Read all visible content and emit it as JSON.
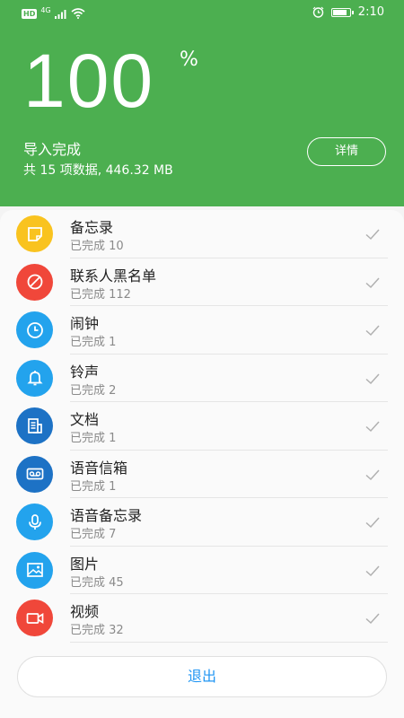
{
  "status_bar": {
    "hd": "HD",
    "network": "4G",
    "time": "2:10",
    "battery_level": 0.85
  },
  "header": {
    "percent_value": "100",
    "percent_sign": "%",
    "import_status": "导入完成",
    "summary": "共 15 项数据, 446.32 MB",
    "details_button": "详情"
  },
  "items": [
    {
      "title": "备忘录",
      "sub": "已完成  10",
      "icon": "memo-icon",
      "color": "#f9c31f"
    },
    {
      "title": "联系人黑名单",
      "sub": "已完成  112",
      "icon": "block-icon",
      "color": "#f0473a"
    },
    {
      "title": "闹钟",
      "sub": "已完成  1",
      "icon": "clock-icon",
      "color": "#23a3ed"
    },
    {
      "title": "铃声",
      "sub": "已完成  2",
      "icon": "bell-icon",
      "color": "#23a3ed"
    },
    {
      "title": "文档",
      "sub": "已完成  1",
      "icon": "document-icon",
      "color": "#1d72c5"
    },
    {
      "title": "语音信箱",
      "sub": "已完成  1",
      "icon": "voicemail-icon",
      "color": "#1d72c5"
    },
    {
      "title": "语音备忘录",
      "sub": "已完成  7",
      "icon": "microphone-icon",
      "color": "#23a3ed"
    },
    {
      "title": "图片",
      "sub": "已完成  45",
      "icon": "image-icon",
      "color": "#23a3ed"
    },
    {
      "title": "视频",
      "sub": "已完成  32",
      "icon": "video-icon",
      "color": "#f0473a"
    }
  ],
  "exit_button": "退出",
  "colors": {
    "header_bg": "#4caf50",
    "accent_blue": "#2196f3"
  }
}
